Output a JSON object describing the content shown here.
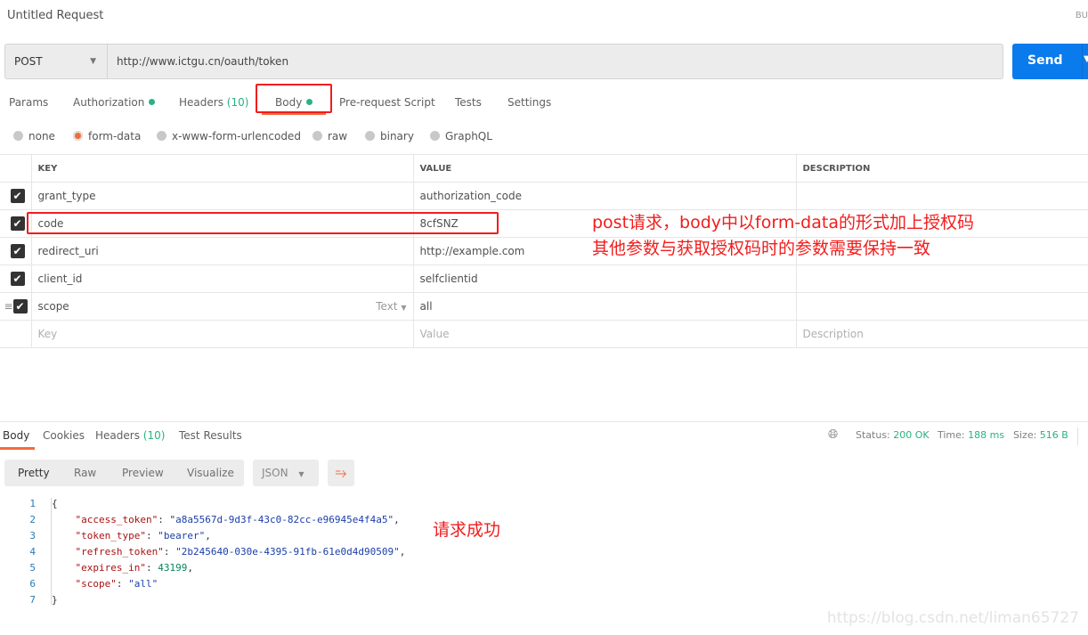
{
  "header": {
    "title": "Untitled Request",
    "right_cutoff": "BU"
  },
  "request": {
    "method": "POST",
    "url": "http://www.ictgu.cn/oauth/token",
    "send_label": "Send"
  },
  "tabs": [
    {
      "label": "Params"
    },
    {
      "label": "Authorization"
    },
    {
      "label": "Headers",
      "count": "(10)"
    },
    {
      "label": "Body"
    },
    {
      "label": "Pre-request Script"
    },
    {
      "label": "Tests"
    },
    {
      "label": "Settings"
    }
  ],
  "body_types": {
    "options": [
      "none",
      "form-data",
      "x-www-form-urlencoded",
      "raw",
      "binary",
      "GraphQL"
    ],
    "selected": "form-data"
  },
  "table": {
    "headers": [
      "KEY",
      "VALUE",
      "DESCRIPTION"
    ],
    "rows": [
      {
        "key": "grant_type",
        "value": "authorization_code"
      },
      {
        "key": "code",
        "value": "8cfSNZ"
      },
      {
        "key": "redirect_uri",
        "value": "http://example.com"
      },
      {
        "key": "client_id",
        "value": "selfclientid"
      },
      {
        "key": "scope",
        "value": "all",
        "type": "Text"
      }
    ],
    "placeholders": {
      "key": "Key",
      "value": "Value",
      "description": "Description"
    }
  },
  "annotations": {
    "line1": "post请求，body中以form-data的形式加上授权码",
    "line2": "其他参数与获取授权码时的参数需要保持一致",
    "success": "请求成功"
  },
  "response": {
    "tabs": [
      {
        "label": "Body"
      },
      {
        "label": "Cookies"
      },
      {
        "label": "Headers",
        "count": "(10)"
      },
      {
        "label": "Test Results"
      }
    ],
    "status_label": "Status:",
    "status": "200 OK",
    "time_label": "Time:",
    "time": "188 ms",
    "size_label": "Size:",
    "size": "516 B",
    "views": [
      "Pretty",
      "Raw",
      "Preview",
      "Visualize"
    ],
    "format": "JSON",
    "json": {
      "access_token": "a8a5567d-9d3f-43c0-82cc-e96945e4f4a5",
      "token_type": "bearer",
      "refresh_token": "2b245640-030e-4395-91fb-61e0d4d90509",
      "expires_in": "43199",
      "scope": "all"
    }
  },
  "colors": {
    "accent": "#f26b3a",
    "send": "#097bed",
    "success": "#26b47f",
    "annotation": "#f21c1c"
  },
  "watermark": "https://blog.csdn.net/liman65727"
}
